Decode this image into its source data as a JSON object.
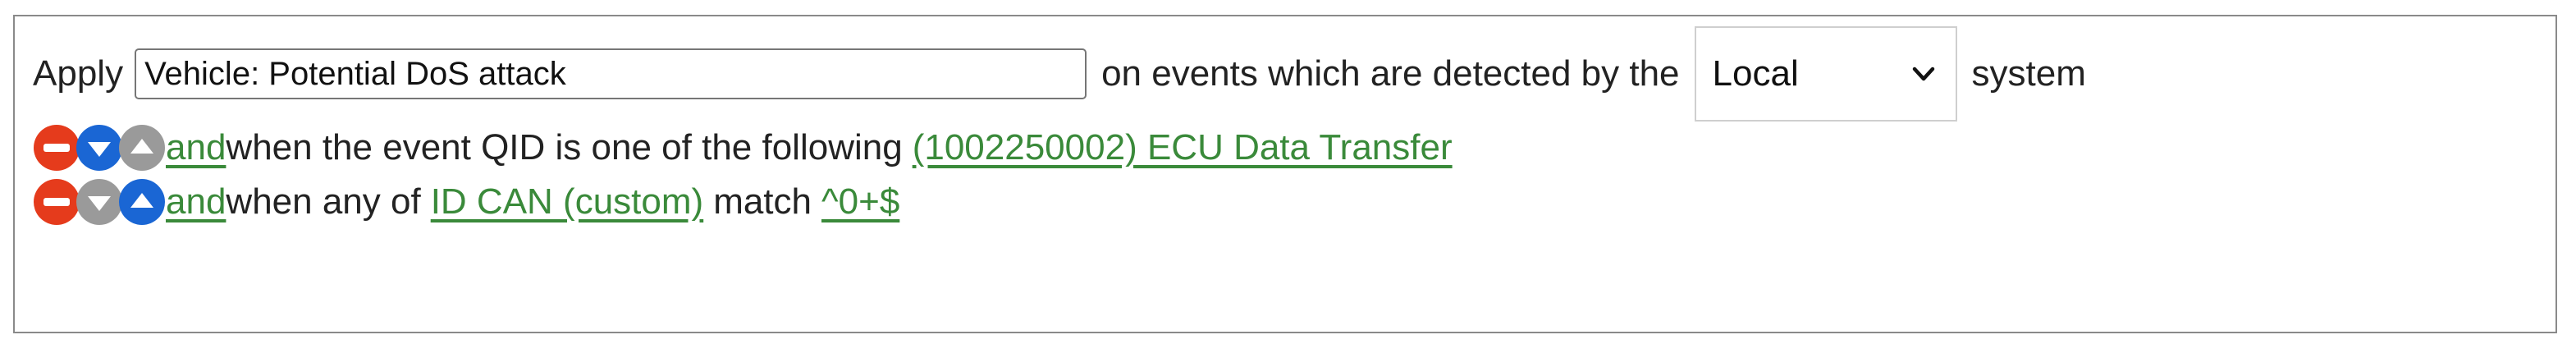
{
  "row1": {
    "apply_label": "Apply",
    "rule_name_value": "Vehicle: Potential DoS attack",
    "events_text": "on events which are detected by the",
    "system_select_value": "Local",
    "system_label": "system"
  },
  "test1": {
    "and_link": " and ",
    "text": "when the event QID is one of the following",
    "value_link": "(1002250002) ECU Data Transfer"
  },
  "test2": {
    "and_link": " and ",
    "text_before": "when any of",
    "field_link": "ID CAN (custom)",
    "text_match": "match",
    "regex_link": "^0+$"
  },
  "colors": {
    "remove": "#e53b1c",
    "move_active": "#1a66d4",
    "move_disabled": "#9a9a9a",
    "link": "#3a8a3a",
    "border": "#8a8a8a"
  },
  "icons": {
    "remove": "remove-icon",
    "move_down": "move-down-icon",
    "move_up": "move-up-icon"
  }
}
